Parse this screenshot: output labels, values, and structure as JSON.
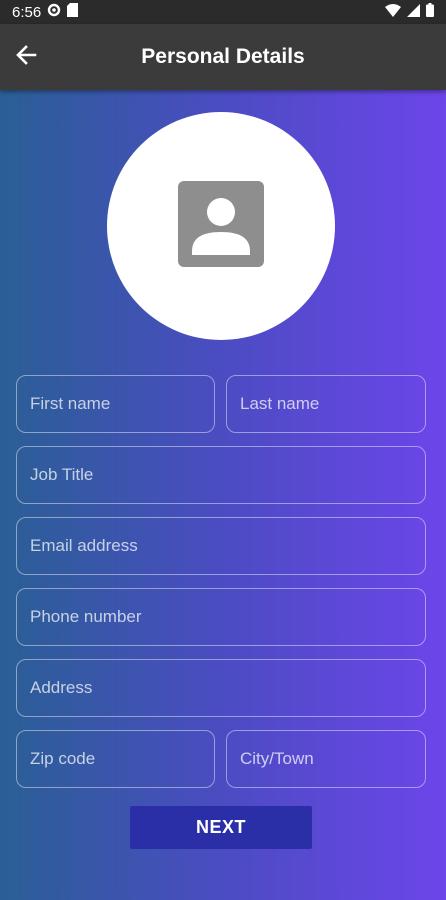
{
  "status_bar": {
    "time": "6:56",
    "icons": [
      "settings-gear-icon",
      "sd-card-icon",
      "wifi-icon",
      "signal-icon",
      "battery-icon"
    ]
  },
  "app_bar": {
    "title": "Personal Details",
    "back_icon": "arrow-left-icon"
  },
  "avatar": {
    "icon": "person-placeholder-icon"
  },
  "form": {
    "first_name": {
      "placeholder": "First name",
      "value": ""
    },
    "last_name": {
      "placeholder": "Last name",
      "value": ""
    },
    "job_title": {
      "placeholder": "Job Title",
      "value": ""
    },
    "email": {
      "placeholder": "Email address",
      "value": ""
    },
    "phone": {
      "placeholder": "Phone number",
      "value": ""
    },
    "address": {
      "placeholder": "Address",
      "value": ""
    },
    "zip": {
      "placeholder": "Zip code",
      "value": ""
    },
    "city": {
      "placeholder": "City/Town",
      "value": ""
    },
    "next_label": "NEXT"
  },
  "colors": {
    "status_bar": "#2b2b2b",
    "app_bar": "#3b3b3b",
    "gradient_start": "#2a5f95",
    "gradient_end": "#6d45ea",
    "button": "#2a2fa8"
  }
}
